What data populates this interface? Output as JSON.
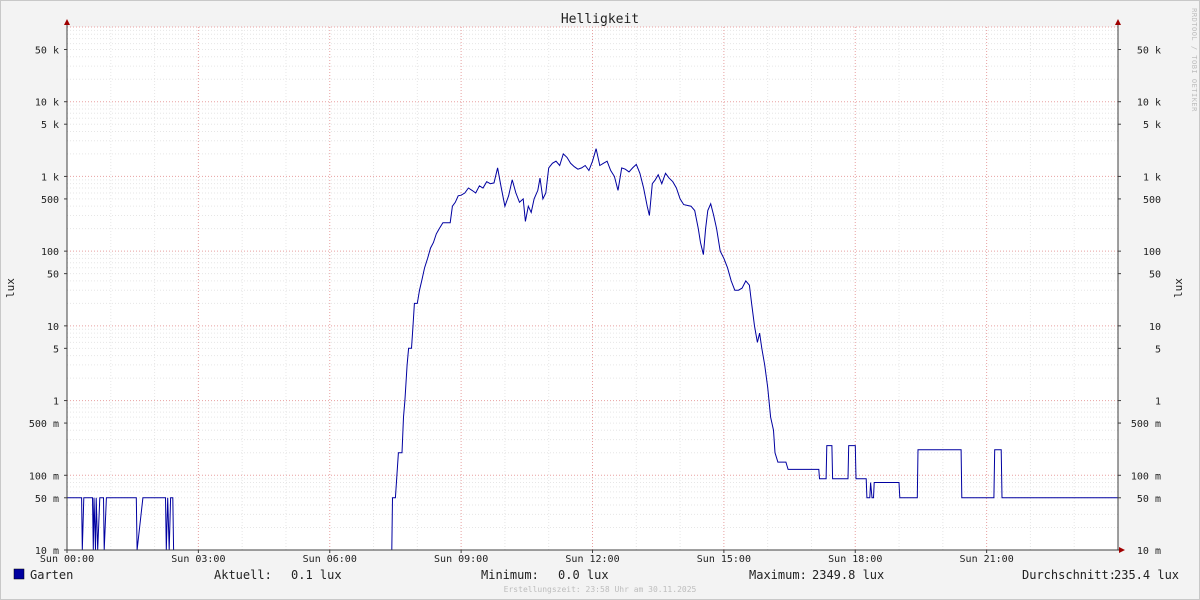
{
  "chart_data": {
    "type": "line",
    "title": "Helligkeit",
    "ylabel": "lux",
    "yscale": "log",
    "ylim": [
      0.01,
      100000
    ],
    "y_ticks": [
      {
        "v": 50000,
        "label": "50 k"
      },
      {
        "v": 10000,
        "label": "10 k"
      },
      {
        "v": 5000,
        "label": "5 k"
      },
      {
        "v": 1000,
        "label": "1 k"
      },
      {
        "v": 500,
        "label": "500"
      },
      {
        "v": 100,
        "label": "100"
      },
      {
        "v": 50,
        "label": "50"
      },
      {
        "v": 10,
        "label": "10"
      },
      {
        "v": 5,
        "label": "5"
      },
      {
        "v": 1,
        "label": "1"
      },
      {
        "v": 0.5,
        "label": "500 m"
      },
      {
        "v": 0.1,
        "label": "100 m"
      },
      {
        "v": 0.05,
        "label": "50 m"
      },
      {
        "v": 0.01,
        "label": "10 m"
      }
    ],
    "xlim": [
      "00:00",
      "24:00"
    ],
    "x_ticks": [
      {
        "h": 0,
        "label": "Sun 00:00"
      },
      {
        "h": 3,
        "label": "Sun 03:00"
      },
      {
        "h": 6,
        "label": "Sun 06:00"
      },
      {
        "h": 9,
        "label": "Sun 09:00"
      },
      {
        "h": 12,
        "label": "Sun 12:00"
      },
      {
        "h": 15,
        "label": "Sun 15:00"
      },
      {
        "h": 18,
        "label": "Sun 18:00"
      },
      {
        "h": 21,
        "label": "Sun 21:00"
      }
    ],
    "grid": true,
    "series": [
      {
        "name": "Garten",
        "color": "#0000a0",
        "points": [
          [
            "00:00",
            0.05
          ],
          [
            "00:20",
            0.05
          ],
          [
            "00:21",
            0.01
          ],
          [
            "00:23",
            0.05
          ],
          [
            "00:35",
            0.05
          ],
          [
            "00:36",
            0.01
          ],
          [
            "00:37",
            0.05
          ],
          [
            "00:39",
            0.01
          ],
          [
            "00:40",
            0.05
          ],
          [
            "00:42",
            0.01
          ],
          [
            "00:45",
            0.05
          ],
          [
            "00:50",
            0.05
          ],
          [
            "00:51",
            0.01
          ],
          [
            "00:54",
            0.05
          ],
          [
            "01:35",
            0.05
          ],
          [
            "01:36",
            0.01
          ],
          [
            "01:44",
            0.05
          ],
          [
            "02:15",
            0.05
          ],
          [
            "02:16",
            0.01
          ],
          [
            "02:18",
            0.05
          ],
          [
            "02:20",
            0.01
          ],
          [
            "02:22",
            0.05
          ],
          [
            "02:25",
            0.05
          ],
          [
            "02:26",
            0.01
          ],
          [
            "07:25",
            0.01
          ],
          [
            "07:26",
            0.05
          ],
          [
            "07:30",
            0.05
          ],
          [
            "07:32",
            0.1
          ],
          [
            "07:34",
            0.2
          ],
          [
            "07:39",
            0.2
          ],
          [
            "07:41",
            0.6
          ],
          [
            "07:43",
            1
          ],
          [
            "07:46",
            3
          ],
          [
            "07:48",
            5
          ],
          [
            "07:52",
            5
          ],
          [
            "07:54",
            10
          ],
          [
            "07:56",
            20
          ],
          [
            "08:00",
            20
          ],
          [
            "08:03",
            30
          ],
          [
            "08:06",
            40
          ],
          [
            "08:10",
            60
          ],
          [
            "08:14",
            80
          ],
          [
            "08:18",
            110
          ],
          [
            "08:22",
            130
          ],
          [
            "08:26",
            170
          ],
          [
            "08:30",
            200
          ],
          [
            "08:35",
            240
          ],
          [
            "08:45",
            240
          ],
          [
            "08:48",
            400
          ],
          [
            "08:52",
            450
          ],
          [
            "08:56",
            550
          ],
          [
            "09:00",
            560
          ],
          [
            "09:05",
            600
          ],
          [
            "09:10",
            700
          ],
          [
            "09:15",
            650
          ],
          [
            "09:20",
            600
          ],
          [
            "09:25",
            750
          ],
          [
            "09:30",
            700
          ],
          [
            "09:35",
            850
          ],
          [
            "09:40",
            800
          ],
          [
            "09:45",
            820
          ],
          [
            "09:50",
            1300
          ],
          [
            "09:55",
            700
          ],
          [
            "10:00",
            400
          ],
          [
            "10:05",
            550
          ],
          [
            "10:10",
            900
          ],
          [
            "10:15",
            600
          ],
          [
            "10:20",
            450
          ],
          [
            "10:25",
            500
          ],
          [
            "10:28",
            250
          ],
          [
            "10:32",
            400
          ],
          [
            "10:36",
            330
          ],
          [
            "10:40",
            500
          ],
          [
            "10:45",
            650
          ],
          [
            "10:48",
            950
          ],
          [
            "10:52",
            500
          ],
          [
            "10:56",
            600
          ],
          [
            "11:00",
            1300
          ],
          [
            "11:05",
            1500
          ],
          [
            "11:10",
            1600
          ],
          [
            "11:15",
            1400
          ],
          [
            "11:20",
            2000
          ],
          [
            "11:25",
            1800
          ],
          [
            "11:30",
            1500
          ],
          [
            "11:35",
            1350
          ],
          [
            "11:40",
            1250
          ],
          [
            "11:45",
            1300
          ],
          [
            "11:50",
            1400
          ],
          [
            "11:55",
            1200
          ],
          [
            "12:00",
            1600
          ],
          [
            "12:05",
            2350
          ],
          [
            "12:10",
            1400
          ],
          [
            "12:15",
            1500
          ],
          [
            "12:20",
            1600
          ],
          [
            "12:25",
            1200
          ],
          [
            "12:30",
            1000
          ],
          [
            "12:35",
            650
          ],
          [
            "12:40",
            1300
          ],
          [
            "12:45",
            1250
          ],
          [
            "12:50",
            1150
          ],
          [
            "12:55",
            1300
          ],
          [
            "13:00",
            1450
          ],
          [
            "13:05",
            1100
          ],
          [
            "13:10",
            700
          ],
          [
            "13:15",
            400
          ],
          [
            "13:18",
            300
          ],
          [
            "13:22",
            800
          ],
          [
            "13:26",
            900
          ],
          [
            "13:30",
            1050
          ],
          [
            "13:35",
            800
          ],
          [
            "13:40",
            1100
          ],
          [
            "13:45",
            950
          ],
          [
            "13:50",
            850
          ],
          [
            "13:55",
            700
          ],
          [
            "14:00",
            500
          ],
          [
            "14:05",
            420
          ],
          [
            "14:15",
            400
          ],
          [
            "14:20",
            350
          ],
          [
            "14:25",
            200
          ],
          [
            "14:28",
            130
          ],
          [
            "14:32",
            90
          ],
          [
            "14:35",
            200
          ],
          [
            "14:38",
            350
          ],
          [
            "14:42",
            430
          ],
          [
            "14:46",
            300
          ],
          [
            "14:50",
            200
          ],
          [
            "14:55",
            100
          ],
          [
            "15:00",
            80
          ],
          [
            "15:05",
            60
          ],
          [
            "15:10",
            40
          ],
          [
            "15:15",
            30
          ],
          [
            "15:20",
            30
          ],
          [
            "15:25",
            32
          ],
          [
            "15:30",
            40
          ],
          [
            "15:35",
            35
          ],
          [
            "15:38",
            20
          ],
          [
            "15:42",
            10
          ],
          [
            "15:46",
            6
          ],
          [
            "15:49",
            8
          ],
          [
            "15:52",
            5
          ],
          [
            "15:56",
            3
          ],
          [
            "16:00",
            1.5
          ],
          [
            "16:04",
            0.6
          ],
          [
            "16:08",
            0.4
          ],
          [
            "16:10",
            0.2
          ],
          [
            "16:14",
            0.15
          ],
          [
            "16:25",
            0.15
          ],
          [
            "16:28",
            0.12
          ],
          [
            "17:10",
            0.12
          ],
          [
            "17:11",
            0.09
          ],
          [
            "17:20",
            0.09
          ],
          [
            "17:21",
            0.25
          ],
          [
            "17:28",
            0.25
          ],
          [
            "17:29",
            0.09
          ],
          [
            "17:50",
            0.09
          ],
          [
            "17:51",
            0.25
          ],
          [
            "18:00",
            0.25
          ],
          [
            "18:01",
            0.09
          ],
          [
            "18:15",
            0.09
          ],
          [
            "18:16",
            0.05
          ],
          [
            "18:20",
            0.05
          ],
          [
            "18:21",
            0.08
          ],
          [
            "18:23",
            0.05
          ],
          [
            "18:25",
            0.05
          ],
          [
            "18:26",
            0.08
          ],
          [
            "19:00",
            0.08
          ],
          [
            "19:01",
            0.05
          ],
          [
            "19:25",
            0.05
          ],
          [
            "19:26",
            0.22
          ],
          [
            "20:25",
            0.22
          ],
          [
            "20:26",
            0.05
          ],
          [
            "21:10",
            0.05
          ],
          [
            "21:11",
            0.22
          ],
          [
            "21:20",
            0.22
          ],
          [
            "21:21",
            0.05
          ],
          [
            "24:00",
            0.05
          ]
        ]
      }
    ],
    "legend": {
      "placement": "bottom",
      "series_label": "Garten",
      "stats": [
        {
          "label": "Aktuell:",
          "value": "0.1 lux"
        },
        {
          "label": "Minimum:",
          "value": "0.0 lux"
        },
        {
          "label": "Maximum:",
          "value": "2349.8 lux"
        },
        {
          "label": "Durchschnitt:",
          "value": "235.4 lux"
        }
      ]
    },
    "watermark": "RRDTOOL / TOBI OETIKER",
    "footer": "Erstellungszeit: 23:58 Uhr am 30.11.2025"
  }
}
